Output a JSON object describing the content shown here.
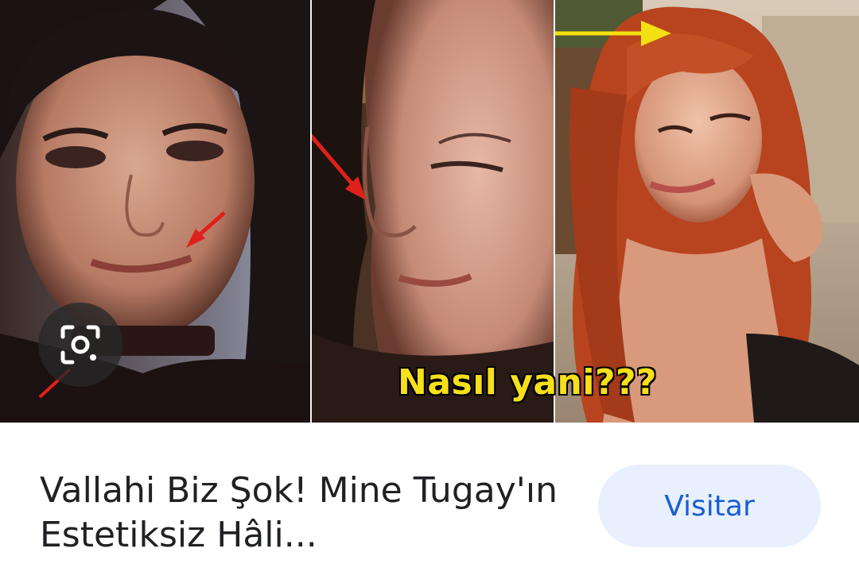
{
  "result_card": {
    "image": {
      "overlay_caption": "Nasıl yani???",
      "lens_icon": "google-lens-icon",
      "panels": [
        {
          "description_icon": "woman-dark-hair-photo"
        },
        {
          "description_icon": "woman-profile-photo"
        },
        {
          "description_icon": "woman-red-hair-photo"
        }
      ]
    },
    "title": "Vallahi Biz Şok! Mine Tugay'ın Estetiksiz Hâli...",
    "visit_label": "Visitar"
  },
  "colors": {
    "visit_bg": "#e8f0fe",
    "visit_text": "#1a5fd0",
    "caption_yellow": "#f6e01a",
    "arrow_red": "#e0201a",
    "arrow_yellow": "#f2e012"
  }
}
